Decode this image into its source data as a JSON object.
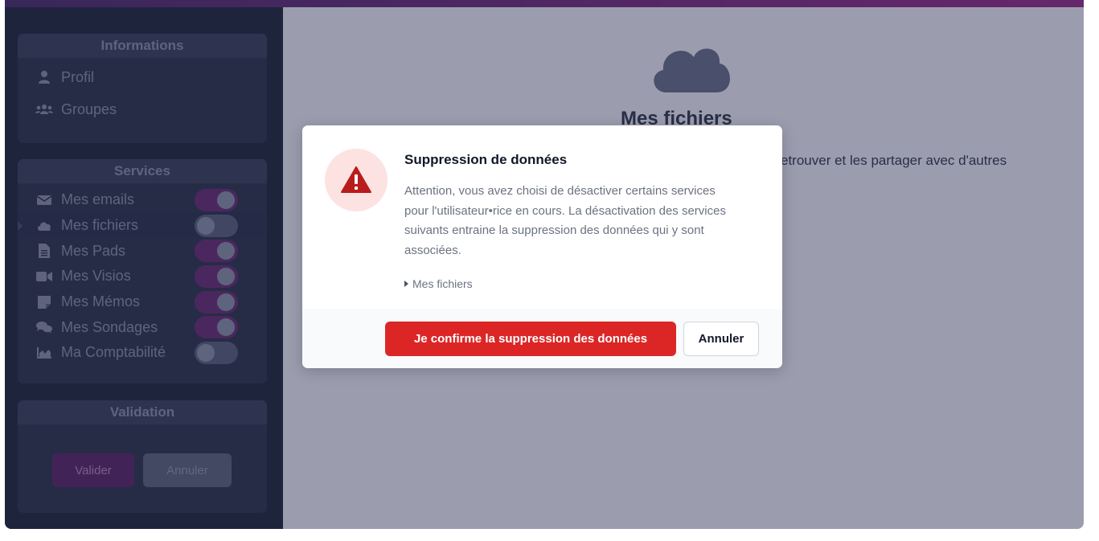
{
  "sidebar": {
    "informations": {
      "title": "Informations",
      "items": [
        {
          "label": "Profil",
          "icon": "user-icon"
        },
        {
          "label": "Groupes",
          "icon": "users-icon"
        }
      ]
    },
    "services": {
      "title": "Services",
      "items": [
        {
          "label": "Mes emails",
          "icon": "envelope-icon",
          "enabled": true
        },
        {
          "label": "Mes fichiers",
          "icon": "cloud-icon",
          "enabled": false
        },
        {
          "label": "Mes Pads",
          "icon": "file-icon",
          "enabled": true
        },
        {
          "label": "Mes Visios",
          "icon": "video-icon",
          "enabled": true
        },
        {
          "label": "Mes Mémos",
          "icon": "note-icon",
          "enabled": true
        },
        {
          "label": "Mes Sondages",
          "icon": "comments-icon",
          "enabled": true
        },
        {
          "label": "Ma Comptabilité",
          "icon": "chart-area-icon",
          "enabled": false
        }
      ]
    },
    "validation": {
      "title": "Validation",
      "validate_label": "Valider",
      "cancel_label": "Annuler"
    }
  },
  "main": {
    "title": "Mes fichiers",
    "description": "etrouver et les partager avec d'autres"
  },
  "modal": {
    "title": "Suppression de données",
    "text": "Attention, vous avez choisi de désactiver certains services pour l'utilisateur•rice en cours. La désactivation des services suivants entraine la suppression des données qui y sont associées.",
    "detail": "Mes fichiers",
    "confirm_label": "Je confirme la suppression des données",
    "cancel_label": "Annuler"
  },
  "colors": {
    "accent": "#6b2a72",
    "danger": "#dc2626",
    "sidebar_bg": "#202538",
    "overlay": "#202446"
  }
}
